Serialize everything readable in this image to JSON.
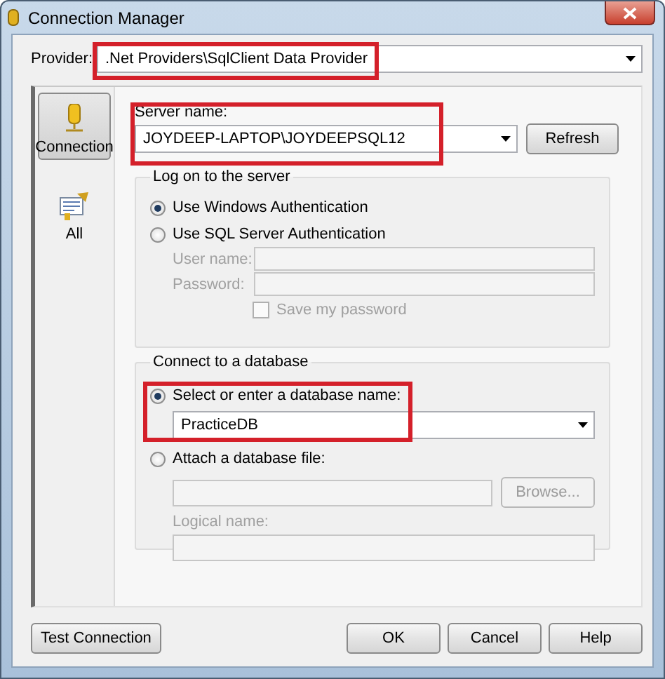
{
  "window": {
    "title": "Connection Manager"
  },
  "provider": {
    "label": "Provider:",
    "value": ".Net Providers\\SqlClient Data Provider",
    "highlighted": true
  },
  "sidebar": {
    "items": [
      {
        "kind": "connection",
        "label": "Connection",
        "selected": true
      },
      {
        "kind": "all",
        "label": "All",
        "selected": false
      }
    ]
  },
  "server": {
    "label": "Server name:",
    "value": "JOYDEEP-LAPTOP\\JOYDEEPSQL12",
    "highlighted": true,
    "refresh": "Refresh"
  },
  "logon": {
    "title": "Log on to the server",
    "options": [
      {
        "label": "Use Windows Authentication",
        "selected": true
      },
      {
        "label": "Use SQL Server Authentication",
        "selected": false
      }
    ],
    "fields": [
      {
        "label": "User name:",
        "disabled": true
      },
      {
        "label": "Password:",
        "disabled": true
      }
    ],
    "save_password": {
      "label": "Save my password",
      "checked": false,
      "disabled": true
    }
  },
  "database": {
    "title": "Connect to a database",
    "options": [
      {
        "label": "Select or enter a database name:",
        "selected": true,
        "highlighted": true
      },
      {
        "label": "Attach a database file:",
        "selected": false
      }
    ],
    "database_name": "PracticeDB",
    "browse": {
      "label": "Browse...",
      "disabled": true
    },
    "logical_name": {
      "label": "Logical name:",
      "disabled": true
    }
  },
  "buttons": [
    {
      "label": "Test Connection"
    },
    {
      "label": "OK"
    },
    {
      "label": "Cancel"
    },
    {
      "label": "Help"
    }
  ]
}
